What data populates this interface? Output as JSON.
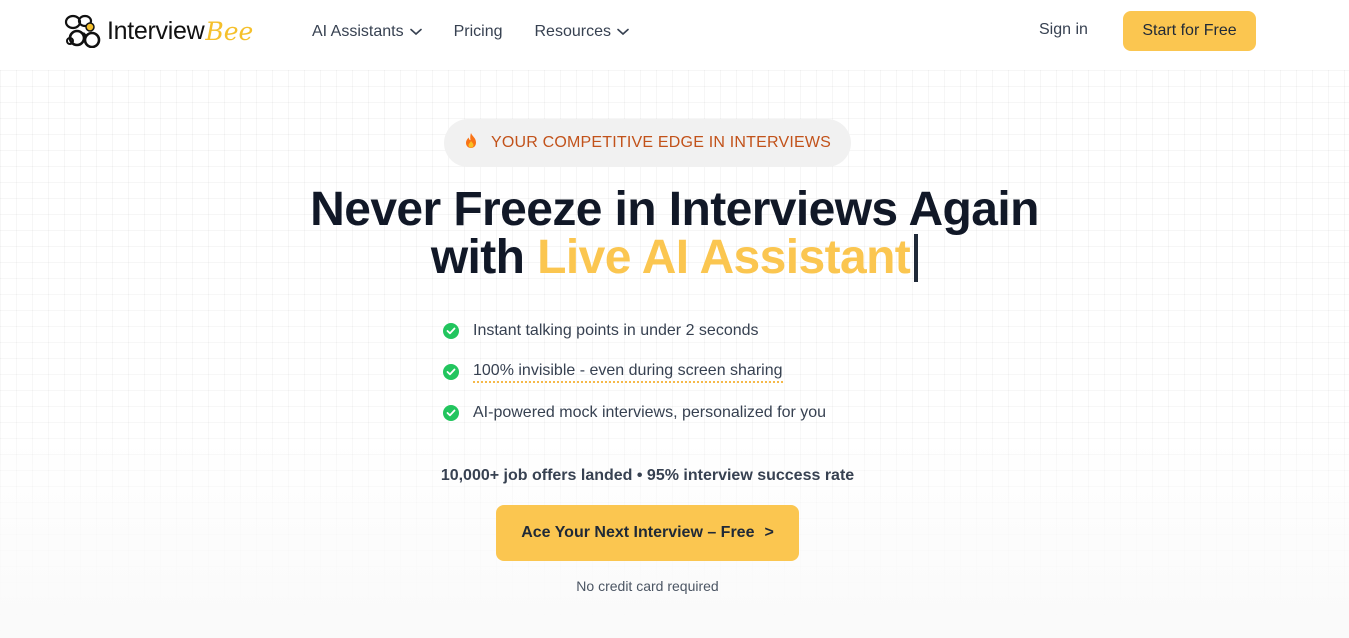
{
  "header": {
    "logo_text": "Interview",
    "logo_accent": "Bee",
    "nav": [
      {
        "label": "AI Assistants",
        "has_dropdown": true
      },
      {
        "label": "Pricing",
        "has_dropdown": false
      },
      {
        "label": "Resources",
        "has_dropdown": true
      }
    ],
    "sign_in": "Sign in",
    "start_button": "Start for Free"
  },
  "hero": {
    "badge_icon": "fire-icon",
    "badge_text": "YOUR COMPETITIVE EDGE IN INTERVIEWS",
    "headline_line1": "Never Freeze in Interviews Again",
    "headline_line2_prefix": "with ",
    "headline_line2_accent": "Live AI Assistant",
    "features": [
      "Instant talking points in under 2 seconds",
      "100% invisible - even during screen sharing",
      "AI-powered mock interviews, personalized for you"
    ],
    "stats": "10,000+ job offers landed • 95% interview success rate",
    "cta_label": "Ace Your Next Interview – Free",
    "cta_arrow": ">",
    "note": "No credit card required"
  },
  "colors": {
    "accent": "#fbc650",
    "badge_text": "#c2521a",
    "check": "#22c55e",
    "text_dark": "#111827"
  }
}
